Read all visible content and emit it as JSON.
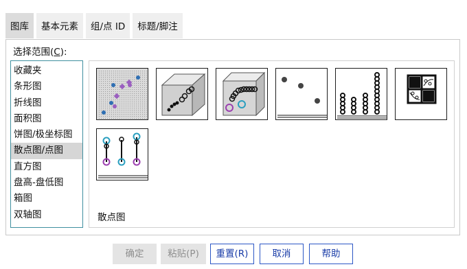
{
  "tabs": [
    {
      "label": "图库"
    },
    {
      "label": "基本元素"
    },
    {
      "label": "组/点 ID"
    },
    {
      "label": "标题/脚注"
    }
  ],
  "range_label": {
    "text": "选择范围(",
    "hotkey": "C",
    "suffix": "):"
  },
  "chart_types": [
    {
      "label": "收藏夹"
    },
    {
      "label": "条形图"
    },
    {
      "label": "折线图"
    },
    {
      "label": "面积图"
    },
    {
      "label": "饼图/极坐标图"
    },
    {
      "label": "散点图/点图"
    },
    {
      "label": "直方图"
    },
    {
      "label": "盘高-盘低图"
    },
    {
      "label": "箱图"
    },
    {
      "label": "双轴图"
    }
  ],
  "selected_index": 5,
  "gallery": {
    "caption": "散点图",
    "thumbnails": [
      {
        "name": "simple-scatter"
      },
      {
        "name": "3d-scatter"
      },
      {
        "name": "overlay-scatter"
      },
      {
        "name": "simple-dot-plot"
      },
      {
        "name": "stacked-dot-plot"
      },
      {
        "name": "scatter-matrix"
      },
      {
        "name": "drop-line"
      }
    ]
  },
  "buttons": {
    "ok": "确定",
    "paste": "粘贴(P)",
    "reset": "重置(R)",
    "cancel": "取消",
    "help": "帮助"
  }
}
